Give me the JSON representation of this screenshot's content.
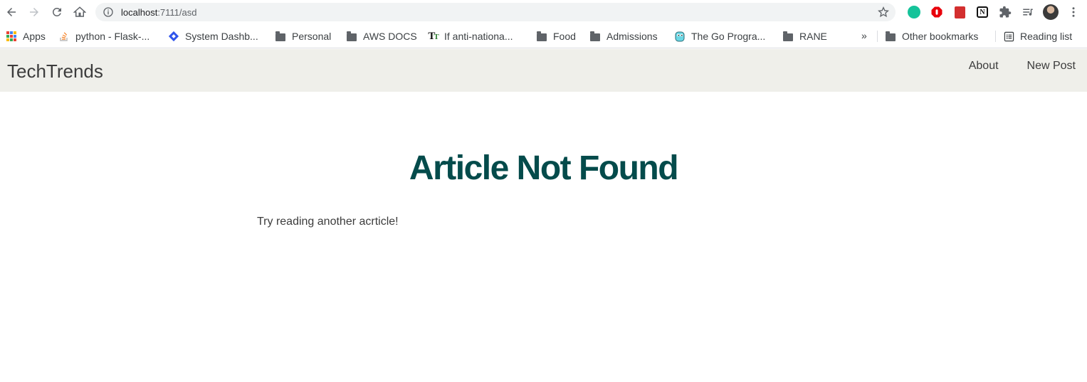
{
  "browser": {
    "url_host": "localhost",
    "url_rest": ":7111/asd",
    "bookmarks": [
      {
        "label": "Apps",
        "icon": "apps-grid-icon"
      },
      {
        "label": "python - Flask-...",
        "icon": "stackoverflow-icon"
      },
      {
        "label": "System Dashb...",
        "icon": "diamond-icon"
      },
      {
        "label": "Personal",
        "icon": "folder-icon"
      },
      {
        "label": "AWS DOCS",
        "icon": "folder-icon"
      },
      {
        "label": "If anti-nationa...",
        "icon": "text-t-icon"
      },
      {
        "label": "Food",
        "icon": "folder-icon"
      },
      {
        "label": "Admissions",
        "icon": "folder-icon"
      },
      {
        "label": "The Go Progra...",
        "icon": "gopher-icon"
      },
      {
        "label": "RANE",
        "icon": "folder-icon"
      }
    ],
    "overflow_chevron": "»",
    "other_bookmarks": "Other bookmarks",
    "reading_list": "Reading list",
    "colors": {
      "grammarly": "#15c39a",
      "adblock": "#e8000b",
      "red_ext": "#d32f2f"
    }
  },
  "site": {
    "brand": "TechTrends",
    "nav": [
      {
        "label": "About"
      },
      {
        "label": "New Post"
      }
    ],
    "nav_bg": "#efefea"
  },
  "main": {
    "heading": "Article Not Found",
    "message": "Try reading another acrticle!",
    "heading_color": "#044b4b"
  }
}
